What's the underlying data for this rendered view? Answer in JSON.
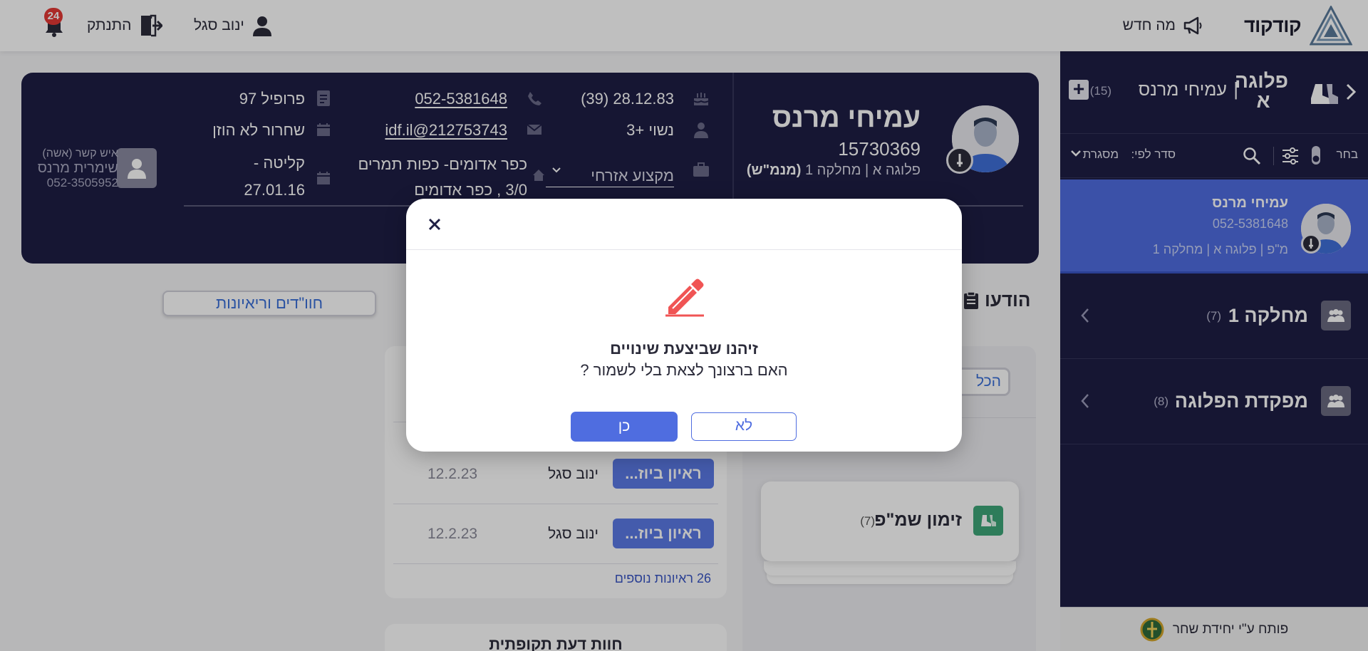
{
  "topbar": {
    "logo_text": "קודקוד",
    "whats_new": "מה חדש",
    "user_name": "ינוב סגל",
    "logout": "התנתק",
    "notifications_count": "24"
  },
  "sidebar": {
    "title": "פלוגה א",
    "separator": "|",
    "name": "עמיחי מרנס",
    "count": "(15)",
    "add_label": "+",
    "filter": {
      "select_label": "בחר",
      "sort_label": "סדר לפי:",
      "sort_value": "מסגרת"
    },
    "selected_card": {
      "name": "עמיחי מרנס",
      "phone": "052-5381648",
      "unit": "מ\"פ | פלוגה א | מחלקה 1"
    },
    "groups": [
      {
        "name": "מחלקה 1",
        "count": "(7)"
      },
      {
        "name": "מפקדת הפלוגה",
        "count": "(8)"
      }
    ],
    "footer": "פותח ע\"י יחידת שחר"
  },
  "profile": {
    "name": "עמיחי מרנס",
    "personal_number": "15730369",
    "unit": "פלוגה א | מחלקה 1",
    "role": "(מנמ\"ש)",
    "birth": "28.12.83 (39)",
    "phone": "052-5381648",
    "profile": "פרופיל 97",
    "marital": "נשוי +3",
    "email": "212753743@idf.il",
    "release": "שחרור לא הוזן",
    "occupation": "מקצוע אזרחי",
    "address_line1": "כפר אדומים- כפות תמרים",
    "address_line2": "3/0 , כפר אדומים",
    "intake_label": "קליטה -",
    "intake_date": "27.01.16",
    "contact_label": "איש קשר (אשה)",
    "contact_name": "שימרית מרנס",
    "contact_phone": "052-3505952"
  },
  "content": {
    "tab_label": "חוו\"דים וריאיונות",
    "section_title": "הודעו",
    "all_button": "הכל",
    "interviews": [
      {
        "type": "ראיון ביוז...",
        "by": "ינוב סגל",
        "date": "12.2.23"
      },
      {
        "type": "ראיון ביוז...",
        "by": "ינוב סגל",
        "date": "12.2.23"
      }
    ],
    "more_interviews": "26 ראיונות נוספים",
    "periodic_title": "חוות דעת תקופתית",
    "summon": {
      "name": "זימון שמ\"פ",
      "count": "(7)"
    }
  },
  "modal": {
    "title": "זיהנו שביצעת שינויים",
    "message": "האם ברצונך לצאת בלי לשמור ?",
    "no_label": "לא",
    "yes_label": "כן"
  },
  "colors": {
    "navy": "#1e1e44",
    "accent_blue": "#4f6de0",
    "badge_red": "#e53935",
    "pencil_red": "#f05454",
    "green": "#3ea678"
  }
}
